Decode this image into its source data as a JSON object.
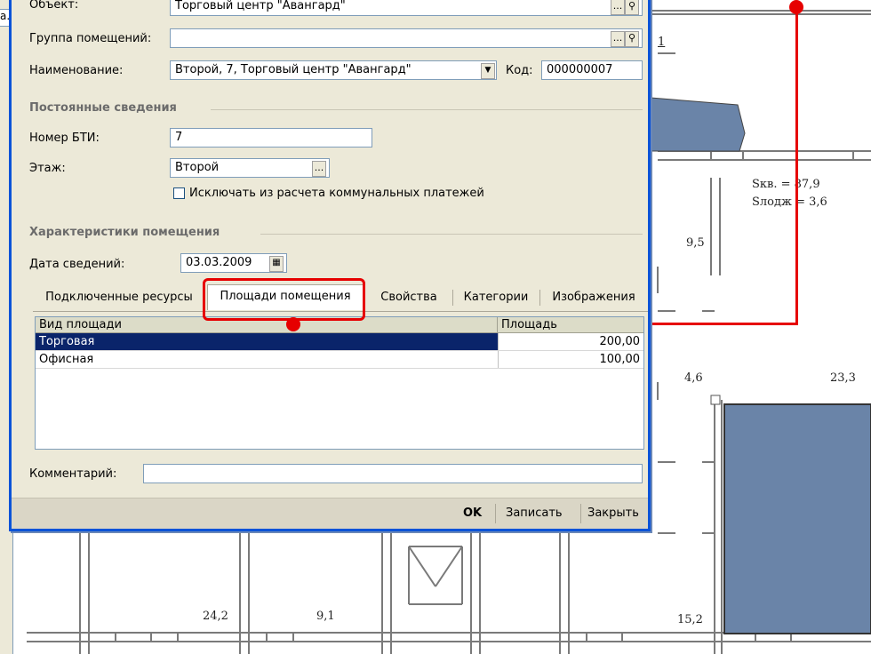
{
  "window_fragment": {
    "text": "а."
  },
  "dialog": {
    "object": {
      "label": "Объект:",
      "value": "Торговый центр \"Авангард\"",
      "ellipsis": "...",
      "search": "search-icon"
    },
    "room_group": {
      "label": "Группа помещений:",
      "value": "",
      "ellipsis": "...",
      "search": "search-icon"
    },
    "name": {
      "label": "Наименование:",
      "value": "Второй, 7, Торговый центр \"Авангард\"",
      "dropdown": "▼"
    },
    "code": {
      "label": "Код:",
      "value": "000000007"
    },
    "section_permanent": "Постоянные сведения",
    "bti_number": {
      "label": "Номер БТИ:",
      "value": "7"
    },
    "floor": {
      "label": "Этаж:",
      "value": "Второй",
      "ellipsis": "..."
    },
    "exclude_checkbox": {
      "label": "Исключать из расчета коммунальных платежей",
      "checked": false
    },
    "section_characteristics": "Характеристики помещения",
    "info_date": {
      "label": "Дата сведений:",
      "value": "03.03.2009",
      "icon": "calendar-icon"
    },
    "tabs": [
      {
        "label": "Подключенные ресурсы"
      },
      {
        "label": "Площади помещения",
        "active": true
      },
      {
        "label": "Свойства"
      },
      {
        "label": "Категории"
      },
      {
        "label": "Изображения"
      }
    ],
    "grid": {
      "columns": [
        "Вид площади",
        "Площадь"
      ],
      "rows": [
        {
          "type": "Торговая",
          "area": "200,00",
          "selected": true
        },
        {
          "type": "Офисная",
          "area": "100,00",
          "selected": false
        }
      ]
    },
    "comment": {
      "label": "Комментарий:",
      "value": ""
    },
    "footer": {
      "ok": "OK",
      "save": "Записать",
      "close": "Закрыть"
    }
  },
  "floor_plan": {
    "labels": {
      "s_main": "Sкв. = 87,9",
      "s_lodge": "Sлодж = 3,6",
      "r1": "9,5",
      "r2": "4,6",
      "r3": "23,3",
      "r4": "24,2",
      "r5": "9,1",
      "r6": "15,2",
      "top_fragment": "1"
    },
    "colors": {
      "fill": "#6a84a8",
      "wall": "#7a7a7a"
    }
  },
  "annotation": {
    "color": "#e60000"
  }
}
